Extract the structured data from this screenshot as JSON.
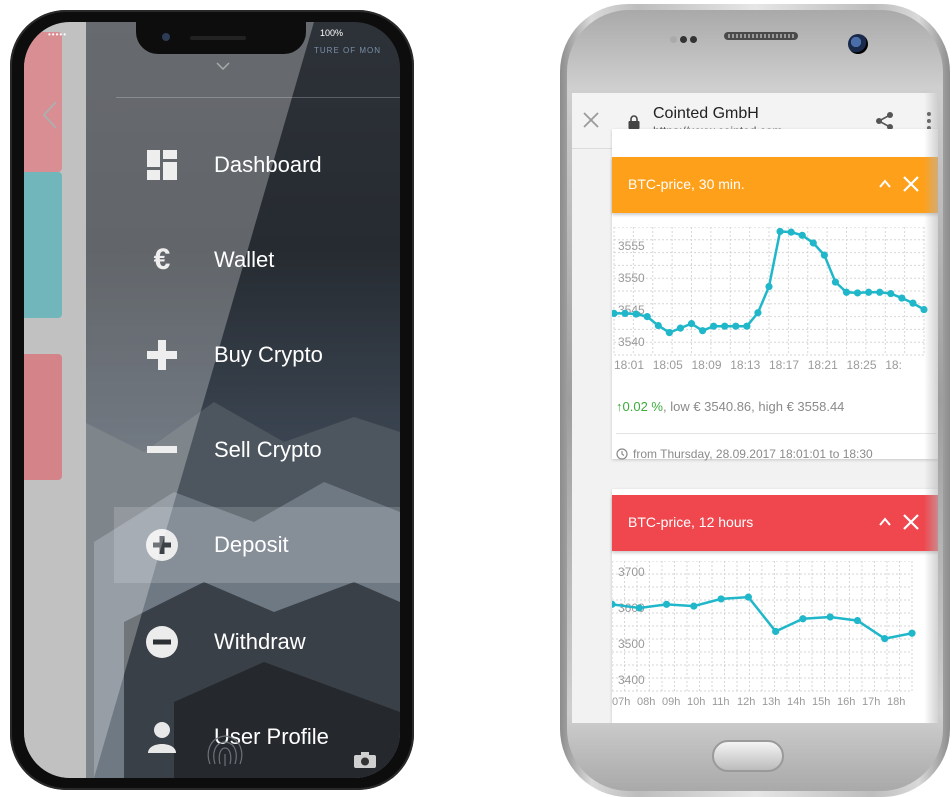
{
  "left_phone": {
    "status_left": "•••••",
    "status_right": "100%",
    "brand_text": "TURE OF MON",
    "menu": [
      {
        "label": "Dashboard",
        "icon": "dashboard-icon",
        "active": false
      },
      {
        "label": "Wallet",
        "icon": "euro-icon",
        "active": false
      },
      {
        "label": "Buy Crypto",
        "icon": "plus-icon",
        "active": false
      },
      {
        "label": "Sell Crypto",
        "icon": "minus-icon",
        "active": false
      },
      {
        "label": "Deposit",
        "icon": "plus-circle-icon",
        "active": true
      },
      {
        "label": "Withdraw",
        "icon": "minus-circle-icon",
        "active": false
      },
      {
        "label": "User Profile",
        "icon": "user-icon",
        "active": false
      }
    ],
    "panel_colors": {
      "card_red": "#c9636a",
      "card_teal": "#3a9aa0",
      "card_red2": "#c4545c"
    }
  },
  "right_phone": {
    "browser": {
      "site_title": "Cointed GmbH",
      "site_url": "https://www.cointed.com"
    },
    "colors": {
      "orange": "#ffa01a",
      "red": "#f0474f",
      "line": "#1fb7c9",
      "up_green": "#3cab3c"
    },
    "card1": {
      "title": "BTC-price, 30 min.",
      "change_pct": "0.02 %",
      "stats_rest": ", low € 3540.86, high € 3558.44",
      "footnote": "from Thursday, 28.09.2017 18:01:01 to 18:30"
    },
    "card2": {
      "title": "BTC-price, 12 hours"
    }
  },
  "chart_data": [
    {
      "type": "line",
      "title": "BTC-price, 30 min.",
      "xlabel": "",
      "ylabel": "",
      "x_ticks": [
        "18:01",
        "18:05",
        "18:09",
        "18:13",
        "18:17",
        "18:21",
        "18:25",
        "18:"
      ],
      "y_ticks": [
        3540,
        3545,
        3550,
        3555
      ],
      "ylim": [
        3538,
        3558
      ],
      "grid": true,
      "series": [
        {
          "values": [
            3544.5,
            3544.5,
            3544.4,
            3544.0,
            3542.6,
            3541.5,
            3542.2,
            3542.9,
            3541.8,
            3542.5,
            3542.5,
            3542.5,
            3542.5,
            3544.6,
            3548.7,
            3557.3,
            3557.2,
            3556.7,
            3555.5,
            3553.6,
            3549.4,
            3547.8,
            3547.7,
            3547.8,
            3547.8,
            3547.6,
            3546.9,
            3546.1,
            3545.1
          ]
        }
      ]
    },
    {
      "type": "line",
      "title": "BTC-price, 12 hours",
      "xlabel": "",
      "ylabel": "",
      "x_ticks": [
        "07h",
        "08h",
        "09h",
        "10h",
        "11h",
        "12h",
        "13h",
        "14h",
        "15h",
        "16h",
        "17h",
        "18h"
      ],
      "y_ticks": [
        3400,
        3500,
        3600,
        3700
      ],
      "ylim": [
        3370,
        3730
      ],
      "grid": true,
      "series": [
        {
          "values": [
            3610,
            3600,
            3610,
            3605,
            3625,
            3630,
            3535,
            3570,
            3575,
            3565,
            3515,
            3530
          ]
        }
      ]
    }
  ]
}
